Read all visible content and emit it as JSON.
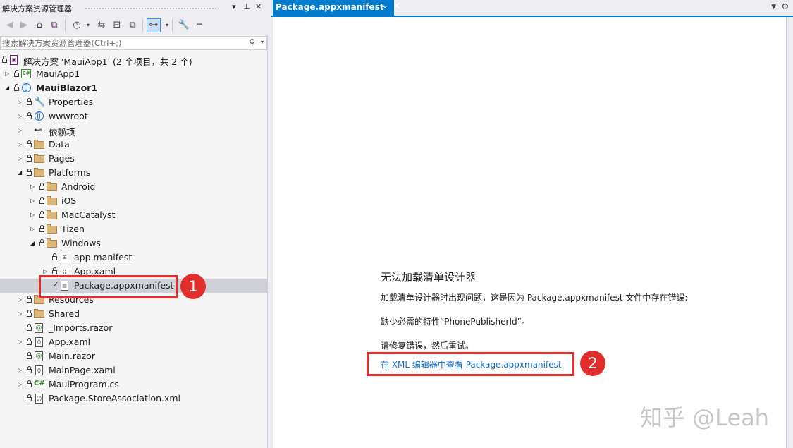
{
  "solution_explorer": {
    "title": "解决方案资源管理器",
    "controls": {
      "dropdown": "▾",
      "pin": "⊥",
      "close": "✕"
    },
    "toolbar": {
      "icons": [
        "back-icon",
        "forward-icon",
        "home-icon",
        "vs-switch-icon",
        "pending-changes-icon",
        "sync-icon",
        "collapse-all-icon",
        "show-all-files-icon",
        "toggle-active-document-icon",
        "properties-icon",
        "preview-icon"
      ]
    },
    "search": {
      "placeholder": "搜索解决方案资源管理器(Ctrl+;)",
      "value": ""
    },
    "tree": [
      {
        "label": "解决方案 'MauiApp1' (2 个项目，共 2 个)",
        "icon": "solution-icon",
        "expander": "",
        "locked": true
      },
      {
        "label": "MauiApp1",
        "icon": "csharp-project-icon",
        "expander": "▷",
        "locked": true
      },
      {
        "label": "MauiBlazor1",
        "icon": "web-project-icon",
        "expander": "◢",
        "locked": true,
        "bold": true
      },
      {
        "label": "Properties",
        "icon": "wrench-icon",
        "expander": "▷",
        "locked": true
      },
      {
        "label": "wwwroot",
        "icon": "globe-icon",
        "expander": "▷",
        "locked": true
      },
      {
        "label": "依赖项",
        "icon": "dependencies-icon",
        "expander": "▷",
        "locked": false
      },
      {
        "label": "Data",
        "icon": "folder-icon",
        "expander": "▷",
        "locked": true
      },
      {
        "label": "Pages",
        "icon": "folder-icon",
        "expander": "▷",
        "locked": true
      },
      {
        "label": "Platforms",
        "icon": "folder-icon",
        "expander": "◢",
        "locked": true
      },
      {
        "label": "Android",
        "icon": "folder-icon",
        "expander": "▷",
        "locked": true
      },
      {
        "label": "iOS",
        "icon": "folder-icon",
        "expander": "▷",
        "locked": true
      },
      {
        "label": "MacCatalyst",
        "icon": "folder-icon",
        "expander": "▷",
        "locked": true
      },
      {
        "label": "Tizen",
        "icon": "folder-icon",
        "expander": "▷",
        "locked": true
      },
      {
        "label": "Windows",
        "icon": "folder-icon",
        "expander": "◢",
        "locked": true
      },
      {
        "label": "app.manifest",
        "icon": "manifest-icon",
        "expander": "",
        "locked": true
      },
      {
        "label": "App.xaml",
        "icon": "xaml-file-icon",
        "expander": "▷",
        "locked": true
      },
      {
        "label": "Package.appxmanifest",
        "icon": "appxmanifest-icon",
        "expander": "",
        "locked": false,
        "checked": true,
        "selected": true
      },
      {
        "label": "Resources",
        "icon": "folder-icon",
        "expander": "▷",
        "locked": true
      },
      {
        "label": "Shared",
        "icon": "folder-icon",
        "expander": "▷",
        "locked": true
      },
      {
        "label": "_Imports.razor",
        "icon": "razor-file-icon",
        "expander": "",
        "locked": true
      },
      {
        "label": "App.xaml",
        "icon": "xaml-file-icon",
        "expander": "▷",
        "locked": true
      },
      {
        "label": "Main.razor",
        "icon": "razor-file-icon",
        "expander": "",
        "locked": true
      },
      {
        "label": "MainPage.xaml",
        "icon": "xaml-file-icon",
        "expander": "▷",
        "locked": true
      },
      {
        "label": "MauiProgram.cs",
        "icon": "csharp-file-icon",
        "expander": "▷",
        "locked": true
      },
      {
        "label": "Package.StoreAssociation.xml",
        "icon": "xml-file-icon",
        "expander": "",
        "locked": true
      }
    ]
  },
  "document_tab": {
    "title": "Package.appxmanifest",
    "pin": "⊸",
    "close": "✕"
  },
  "editor": {
    "error_title": "无法加载清单设计器",
    "error_message": "加载清单设计器时出现问题，这是因为 Package.appxmanifest 文件中存在错误:",
    "error_detail": "缺少必需的特性“PhonePublisherId”。",
    "instruction": "请修复错误，然后重试。",
    "link": "在 XML 编辑器中查看 Package.appxmanifest"
  },
  "annotations": {
    "badge1": "1",
    "badge2": "2"
  },
  "watermark": "知乎 @Leah",
  "colors": {
    "accent": "#007acc",
    "link": "#1a6ec1",
    "annotation_red": "#e22d2d",
    "selection": "#cfd0d8"
  }
}
